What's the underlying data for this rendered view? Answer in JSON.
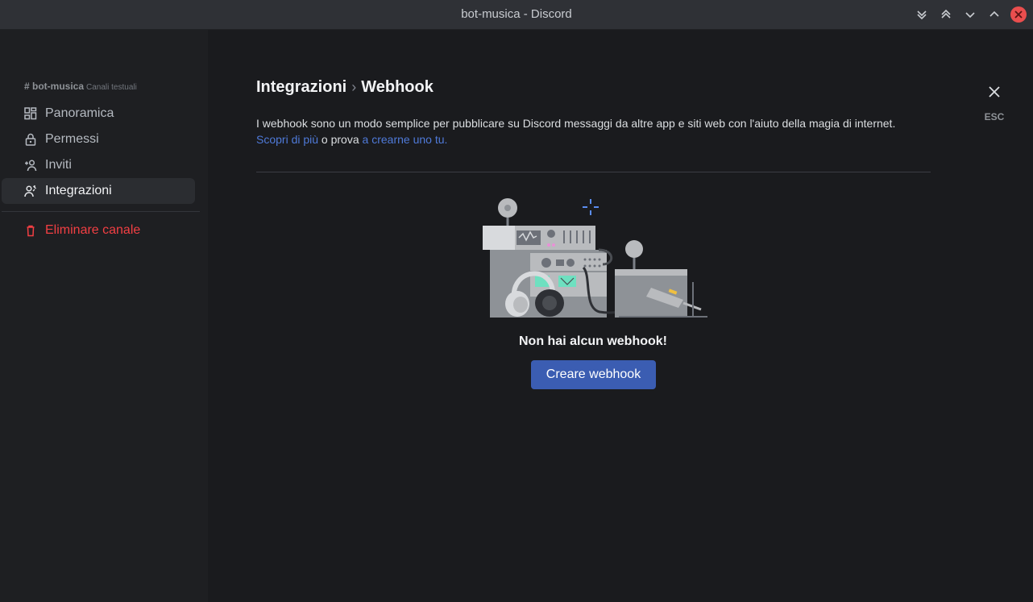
{
  "window": {
    "title": "bot-musica - Discord"
  },
  "sidebar": {
    "channel_name": "# bot-musica",
    "channel_type": "Canali testuali",
    "items": [
      {
        "label": "Panoramica",
        "icon": "grid-icon"
      },
      {
        "label": "Permessi",
        "icon": "lock-icon"
      },
      {
        "label": "Inviti",
        "icon": "add-person-icon"
      },
      {
        "label": "Integrazioni",
        "icon": "integrations-icon",
        "active": true
      }
    ],
    "delete_label": "Eliminare canale"
  },
  "main": {
    "breadcrumb_parent": "Integrazioni",
    "breadcrumb_sep": "›",
    "breadcrumb_current": "Webhook",
    "description": "I webhook sono un modo semplice per pubblicare su Discord messaggi da altre app e siti web con l'aiuto della magia di internet.",
    "learn_more": "Scopri di più",
    "or_try": " o prova ",
    "create_one": "a crearne uno tu.",
    "close_hint": "ESC",
    "empty_title": "Non hai alcun webhook!",
    "create_button": "Creare webhook"
  },
  "colors": {
    "accent": "#3b5db2",
    "link": "#4f7ad9",
    "danger": "#f23f43",
    "close_button": "#ea4e4e"
  }
}
